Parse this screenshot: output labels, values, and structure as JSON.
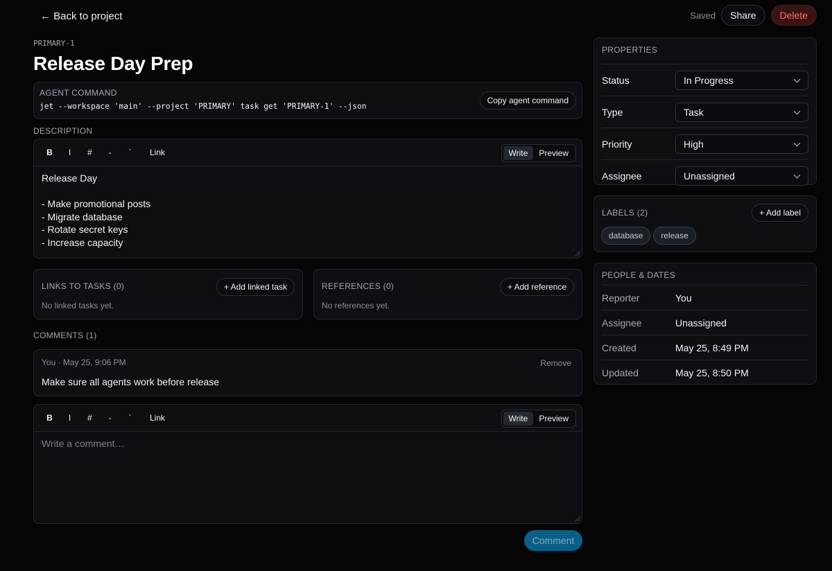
{
  "nav": {
    "back_label": "← Back to project"
  },
  "header_actions": {
    "saved": "Saved",
    "share": "Share",
    "delete": "Delete"
  },
  "task": {
    "id": "PRIMARY-1",
    "title": "Release Day Prep"
  },
  "agent_command": {
    "label": "AGENT COMMAND",
    "command": "jet --workspace 'main' --project 'PRIMARY' task get 'PRIMARY-1' --json",
    "copy_label": "Copy agent command"
  },
  "description": {
    "label": "DESCRIPTION",
    "toolbar": {
      "bold": "B",
      "italic": "I",
      "heading": "#",
      "list": "-",
      "code": "`",
      "link": "Link"
    },
    "write_tab": "Write",
    "preview_tab": "Preview",
    "text": "Release Day\n\n- Make promotional posts\n- Migrate database\n- Rotate secret keys\n- Increase capacity"
  },
  "links": {
    "title": "LINKS TO TASKS (0)",
    "add_label": "+ Add linked task",
    "empty": "No linked tasks yet."
  },
  "references": {
    "title": "REFERENCES (0)",
    "add_label": "+ Add reference",
    "empty": "No references yet."
  },
  "comments": {
    "title": "COMMENTS (1)",
    "items": [
      {
        "meta": "You · May 25, 9:06 PM",
        "remove": "Remove",
        "text": "Make sure all agents work before release"
      }
    ],
    "new": {
      "toolbar": {
        "bold": "B",
        "italic": "I",
        "heading": "#",
        "list": "-",
        "code": "`",
        "link": "Link"
      },
      "write_tab": "Write",
      "preview_tab": "Preview",
      "placeholder": "Write a comment…",
      "submit": "Comment"
    }
  },
  "properties": {
    "title": "PROPERTIES",
    "rows": [
      {
        "key": "Status",
        "value": "In Progress"
      },
      {
        "key": "Type",
        "value": "Task"
      },
      {
        "key": "Priority",
        "value": "High"
      },
      {
        "key": "Assignee",
        "value": "Unassigned"
      }
    ]
  },
  "labels": {
    "title": "LABELS (2)",
    "add_label": "+ Add label",
    "items": [
      "database",
      "release"
    ]
  },
  "people_dates": {
    "title": "PEOPLE & DATES",
    "rows": [
      {
        "key": "Reporter",
        "value": "You"
      },
      {
        "key": "Assignee",
        "value": "Unassigned"
      },
      {
        "key": "Created",
        "value": "May 25, 8:49 PM"
      },
      {
        "key": "Updated",
        "value": "May 25, 8:50 PM"
      }
    ]
  }
}
